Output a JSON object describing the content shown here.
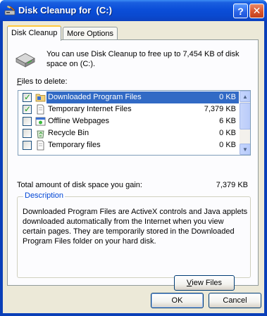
{
  "window": {
    "title": "Disk Cleanup for  (C:)",
    "help_button": "?",
    "close_button": "✕"
  },
  "tabs": [
    {
      "label": "Disk Cleanup",
      "active": true
    },
    {
      "label": "More Options",
      "active": false
    }
  ],
  "intro_text": "You can use Disk Cleanup to free up to 7,454 KB of disk space on  (C:).",
  "files_to_delete": {
    "label_prefix": "F",
    "label_rest": "iles to delete:",
    "items": [
      {
        "name": "Downloaded Program Files",
        "size": "0 KB",
        "checked": true,
        "selected": true,
        "icon": "folder-icon"
      },
      {
        "name": "Temporary Internet Files",
        "size": "7,379 KB",
        "checked": true,
        "selected": false,
        "icon": "document-icon"
      },
      {
        "name": "Offline Webpages",
        "size": "6 KB",
        "checked": false,
        "selected": false,
        "icon": "offline-webpage-icon"
      },
      {
        "name": "Recycle Bin",
        "size": "0 KB",
        "checked": false,
        "selected": false,
        "icon": "recycle-bin-icon"
      },
      {
        "name": "Temporary files",
        "size": "0 KB",
        "checked": false,
        "selected": false,
        "icon": "document-icon"
      }
    ]
  },
  "total": {
    "label": "Total amount of disk space you gain:",
    "value": "7,379 KB"
  },
  "description": {
    "title": "Description",
    "text": "Downloaded Program Files are ActiveX controls and Java applets downloaded automatically from the Internet when you view certain pages. They are temporarily stored in the Downloaded Program Files folder on your hard disk."
  },
  "buttons": {
    "view_files_prefix": "V",
    "view_files_rest": "iew Files",
    "ok": "OK",
    "cancel": "Cancel"
  },
  "colors": {
    "title_bar": "#0b4ed8",
    "selection": "#316ac5",
    "description_title": "#0046d5"
  }
}
